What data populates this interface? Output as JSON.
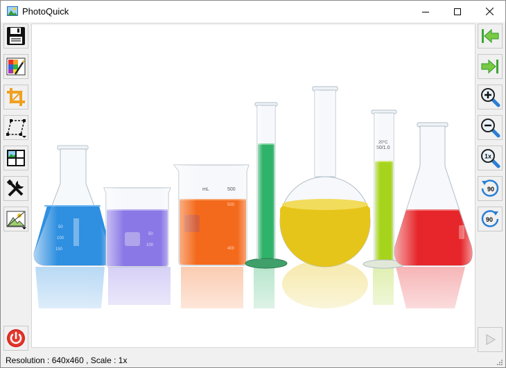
{
  "window": {
    "title": "PhotoQuick",
    "controls": [
      "minimize",
      "maximize",
      "close"
    ]
  },
  "left_toolbar": {
    "items": [
      {
        "name": "save",
        "icon": "save-icon",
        "has_dropdown": false
      },
      {
        "name": "color-adjust",
        "icon": "color-palette-icon",
        "has_dropdown": false
      },
      {
        "name": "crop",
        "icon": "crop-icon",
        "has_dropdown": false
      },
      {
        "name": "transform",
        "icon": "perspective-transform-icon",
        "has_dropdown": true
      },
      {
        "name": "collage",
        "icon": "collage-icon",
        "has_dropdown": false
      },
      {
        "name": "tools",
        "icon": "tools-icon",
        "has_dropdown": false
      },
      {
        "name": "image-effects",
        "icon": "landscape-icon",
        "has_dropdown": true
      }
    ],
    "power": {
      "name": "quit",
      "icon": "power-icon"
    }
  },
  "right_toolbar": {
    "items": [
      {
        "name": "previous",
        "icon": "arrow-left-icon"
      },
      {
        "name": "next",
        "icon": "arrow-right-icon"
      },
      {
        "name": "zoom-in",
        "icon": "zoom-in-icon"
      },
      {
        "name": "zoom-out",
        "icon": "zoom-out-icon"
      },
      {
        "name": "original-size",
        "icon": "zoom-1x-icon",
        "label": "1x"
      },
      {
        "name": "rotate-left",
        "icon": "rotate-left-icon",
        "label": "90"
      },
      {
        "name": "rotate-right",
        "icon": "rotate-right-icon",
        "label": "90"
      }
    ],
    "play": {
      "name": "play",
      "icon": "play-icon",
      "enabled": false
    }
  },
  "image": {
    "description_icon": "lab-glassware-image",
    "vessels": [
      {
        "type": "erlenmeyer",
        "liquid": "#2f8fe0",
        "marks": [
          "50",
          "100",
          "150"
        ]
      },
      {
        "type": "beaker",
        "liquid": "#8a78e6",
        "marks": [
          "50",
          "100"
        ]
      },
      {
        "type": "beaker",
        "liquid": "#f46a1c",
        "marks": [
          "mL",
          "500",
          "400"
        ]
      },
      {
        "type": "cylinder",
        "liquid": "#2fb36a"
      },
      {
        "type": "flask",
        "liquid": "#e6c51a"
      },
      {
        "type": "cylinder",
        "liquid": "#a6d41c",
        "marks": [
          "50/1.0"
        ]
      },
      {
        "type": "erlenmeyer",
        "liquid": "#e6262a"
      }
    ]
  },
  "status": {
    "text": "Resolution : 640x460 , Scale : 1x"
  },
  "colors": {
    "accent_green": "#3fa535",
    "accent_blue": "#2a7fd4",
    "accent_orange": "#f0a020",
    "power_red": "#d8261f"
  }
}
